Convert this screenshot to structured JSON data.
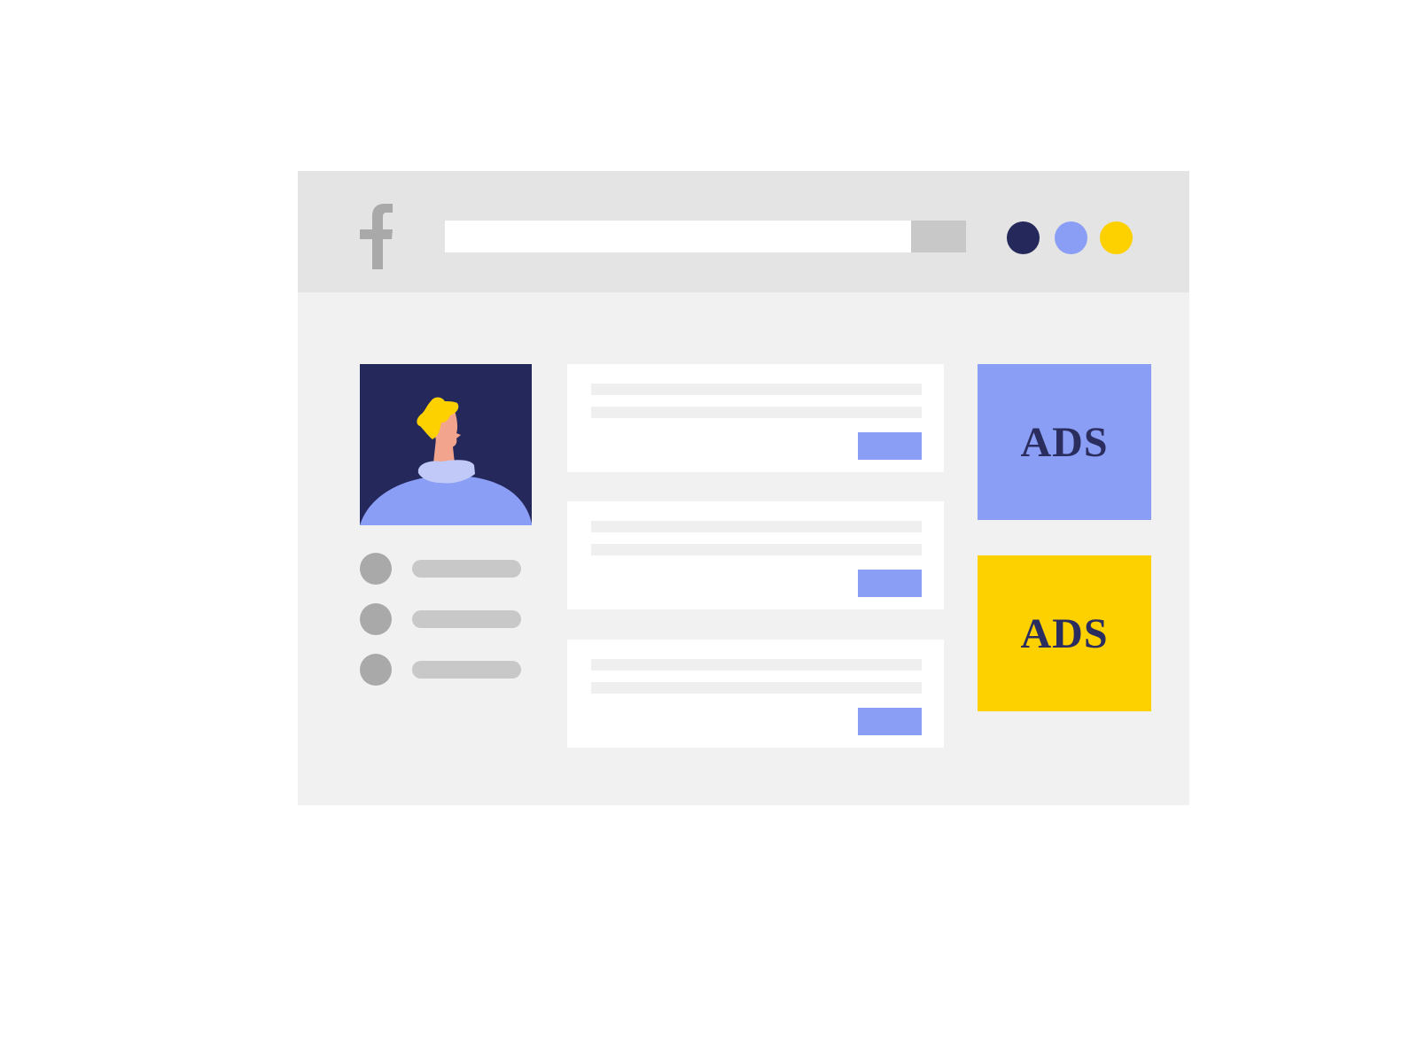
{
  "colors": {
    "page_background": "#ffffff",
    "window_background": "#f1f1f1",
    "topbar_background": "#e4e4e4",
    "logo": "#a9a9a9",
    "search_button": "#c8c8c8",
    "dot_navy": "#25285b",
    "dot_periwinkle": "#8a9ef5",
    "dot_yellow": "#fdd000",
    "post_button": "#8a9ef5",
    "ad_periwinkle": "#8a9ef5",
    "ad_yellow": "#fdd000",
    "ad_text": "#2a2d5e"
  },
  "header": {
    "logo_icon": "facebook-f-logo",
    "search": {
      "value": "",
      "placeholder": ""
    },
    "window_dots": [
      "navy",
      "periwinkle",
      "yellow"
    ]
  },
  "profile": {
    "avatar": "person-illustration",
    "menu_items": [
      {
        "icon": "circle-placeholder",
        "label": ""
      },
      {
        "icon": "circle-placeholder",
        "label": ""
      },
      {
        "icon": "circle-placeholder",
        "label": ""
      }
    ]
  },
  "feed": {
    "posts": [
      {
        "button_label": ""
      },
      {
        "button_label": ""
      },
      {
        "button_label": ""
      }
    ]
  },
  "ads": [
    {
      "label": "ADS",
      "color": "#8a9ef5"
    },
    {
      "label": "ADS",
      "color": "#fdd000"
    }
  ]
}
